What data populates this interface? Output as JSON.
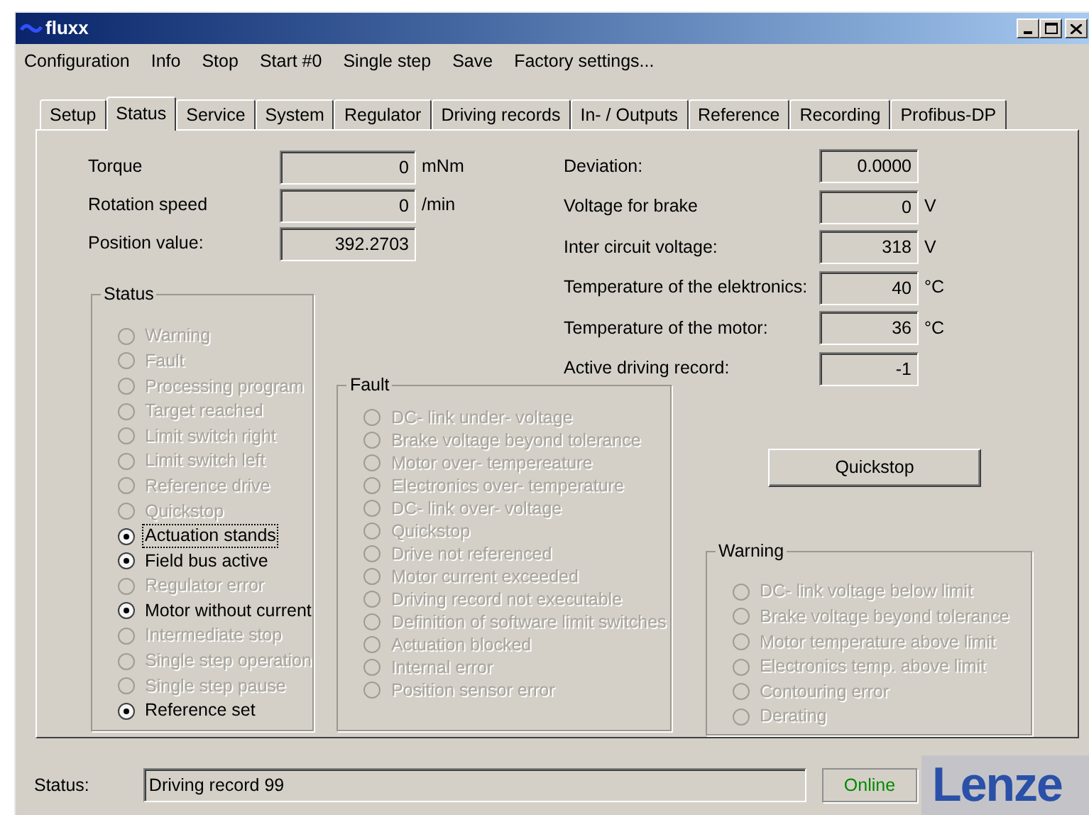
{
  "window": {
    "title": "fluxx"
  },
  "menu": [
    "Configuration",
    "Info",
    "Stop",
    "Start #0",
    "Single step",
    "Save",
    "Factory settings..."
  ],
  "tabs": [
    {
      "label": "Setup",
      "selected": false
    },
    {
      "label": "Status",
      "selected": true
    },
    {
      "label": "Service",
      "selected": false
    },
    {
      "label": "System",
      "selected": false
    },
    {
      "label": "Regulator",
      "selected": false
    },
    {
      "label": "Driving records",
      "selected": false
    },
    {
      "label": "In- / Outputs",
      "selected": false
    },
    {
      "label": "Reference",
      "selected": false
    },
    {
      "label": "Recording",
      "selected": false
    },
    {
      "label": "Profibus-DP",
      "selected": false
    }
  ],
  "readings_left": [
    {
      "label": "Torque",
      "value": "0",
      "unit": "mNm"
    },
    {
      "label": "Rotation speed",
      "value": "0",
      "unit": "/min"
    },
    {
      "label": "Position value:",
      "value": "392.2703"
    }
  ],
  "readings_right": [
    {
      "label": "Deviation:",
      "value": "0.0000"
    },
    {
      "label": "Voltage for brake",
      "value": "0",
      "unit": "V"
    },
    {
      "label": "Inter circuit voltage:",
      "value": "318",
      "unit": "V"
    },
    {
      "label": "Temperature of the elektronics:",
      "value": "40",
      "unit": "°C"
    },
    {
      "label": "Temperature of the motor:",
      "value": "36",
      "unit": "°C"
    },
    {
      "label": "Active driving record:",
      "value": "-1"
    }
  ],
  "status_group": {
    "title": "Status",
    "items": [
      {
        "label": "Warning",
        "checked": false,
        "disabled": true,
        "focused": false
      },
      {
        "label": "Fault",
        "checked": false,
        "disabled": true,
        "focused": false
      },
      {
        "label": "Processing program",
        "checked": false,
        "disabled": true,
        "focused": false
      },
      {
        "label": "Target reached",
        "checked": false,
        "disabled": true,
        "focused": false
      },
      {
        "label": "Limit switch right",
        "checked": false,
        "disabled": true,
        "focused": false
      },
      {
        "label": "Limit switch left",
        "checked": false,
        "disabled": true,
        "focused": false
      },
      {
        "label": "Reference drive",
        "checked": false,
        "disabled": true,
        "focused": false
      },
      {
        "label": "Quickstop",
        "checked": false,
        "disabled": true,
        "focused": false
      },
      {
        "label": "Actuation stands",
        "checked": true,
        "disabled": false,
        "focused": true
      },
      {
        "label": "Field bus active",
        "checked": true,
        "disabled": false,
        "focused": false
      },
      {
        "label": "Regulator error",
        "checked": false,
        "disabled": true,
        "focused": false
      },
      {
        "label": "Motor without current",
        "checked": true,
        "disabled": false,
        "focused": false
      },
      {
        "label": "Intermediate stop",
        "checked": false,
        "disabled": true,
        "focused": false
      },
      {
        "label": "Single step operation",
        "checked": false,
        "disabled": true,
        "focused": false
      },
      {
        "label": "Single step pause",
        "checked": false,
        "disabled": true,
        "focused": false
      },
      {
        "label": "Reference set",
        "checked": true,
        "disabled": false,
        "focused": false
      }
    ]
  },
  "fault_group": {
    "title": "Fault",
    "items": [
      {
        "label": "DC- link under- voltage",
        "checked": false,
        "disabled": true
      },
      {
        "label": "Brake voltage beyond tolerance",
        "checked": false,
        "disabled": true
      },
      {
        "label": "Motor over- tempereature",
        "checked": false,
        "disabled": true
      },
      {
        "label": "Electronics over- temperature",
        "checked": false,
        "disabled": true
      },
      {
        "label": "DC- link over- voltage",
        "checked": false,
        "disabled": true
      },
      {
        "label": "Quickstop",
        "checked": false,
        "disabled": true
      },
      {
        "label": "Drive not referenced",
        "checked": false,
        "disabled": true
      },
      {
        "label": "Motor current exceeded",
        "checked": false,
        "disabled": true
      },
      {
        "label": "Driving record not executable",
        "checked": false,
        "disabled": true
      },
      {
        "label": "Definition of software limit switches",
        "checked": false,
        "disabled": true
      },
      {
        "label": "Actuation blocked",
        "checked": false,
        "disabled": true
      },
      {
        "label": "Internal error",
        "checked": false,
        "disabled": true
      },
      {
        "label": "Position sensor error",
        "checked": false,
        "disabled": true
      }
    ]
  },
  "quickstop_button": "Quickstop",
  "warning_group": {
    "title": "Warning",
    "items": [
      {
        "label": "DC- link voltage below limit",
        "checked": false,
        "disabled": true
      },
      {
        "label": "Brake voltage beyond tolerance",
        "checked": false,
        "disabled": true
      },
      {
        "label": "Motor temperature above limit",
        "checked": false,
        "disabled": true
      },
      {
        "label": "Electronics temp. above limit",
        "checked": false,
        "disabled": true
      },
      {
        "label": "Contouring error",
        "checked": false,
        "disabled": true
      },
      {
        "label": "Derating",
        "checked": false,
        "disabled": true
      }
    ]
  },
  "status_bar": {
    "label": "Status:",
    "value": "Driving record 99",
    "connection": "Online",
    "logo": "Lenze"
  }
}
